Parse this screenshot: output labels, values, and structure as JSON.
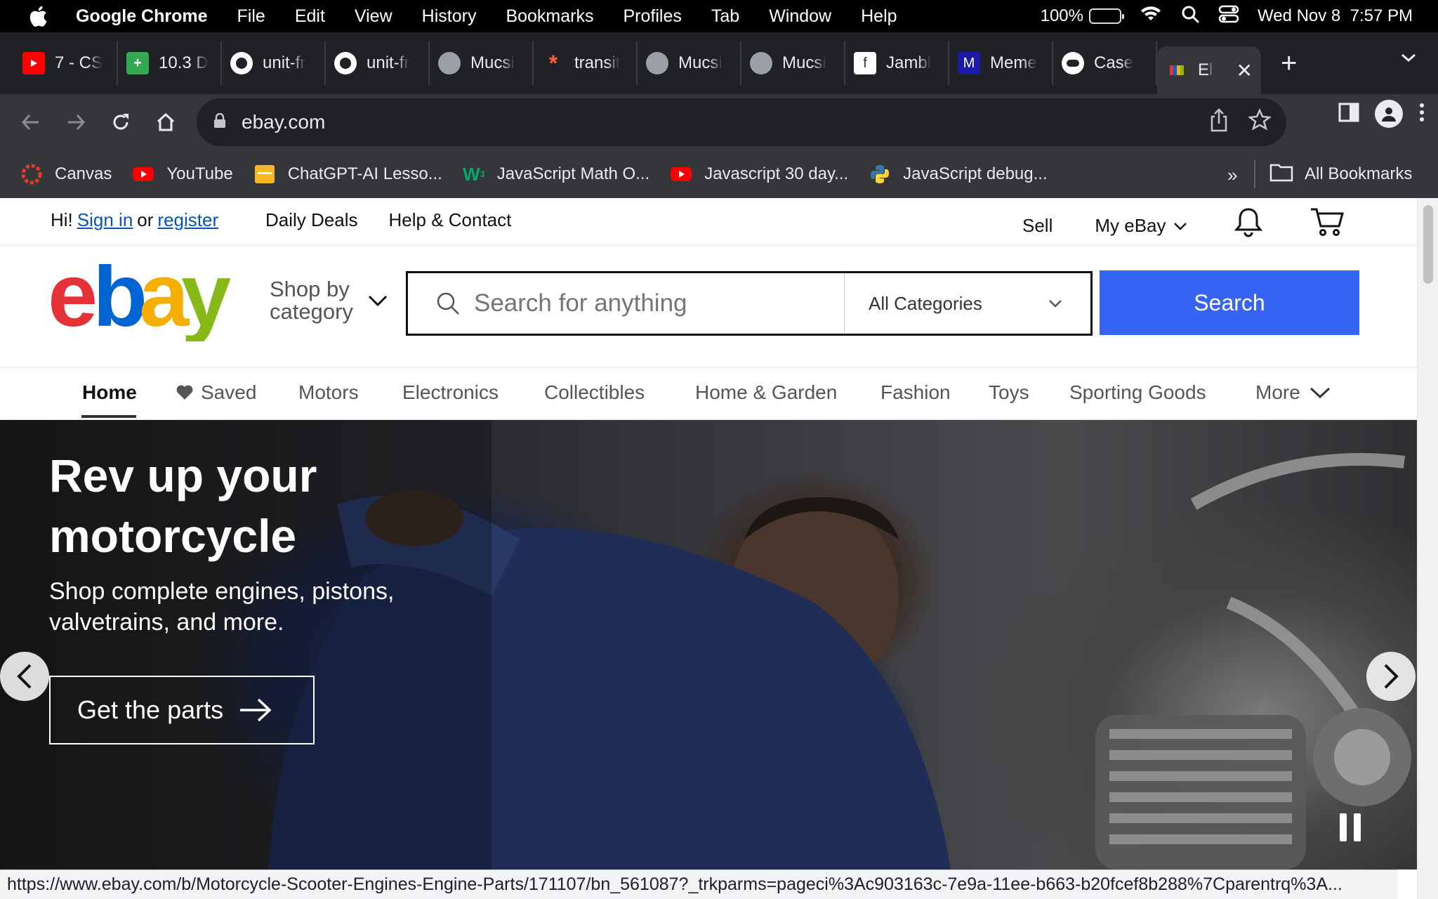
{
  "menubar": {
    "app_name": "Google Chrome",
    "items": [
      "File",
      "Edit",
      "View",
      "History",
      "Bookmarks",
      "Profiles",
      "Tab",
      "Window",
      "Help"
    ],
    "battery": "100%",
    "datetime": "Wed Nov 8  7:57 PM"
  },
  "tabs": [
    {
      "title": "7 - CS",
      "icon": "youtube-icon",
      "color": "#ff0000"
    },
    {
      "title": "10.3 D",
      "icon": "green-plus-icon",
      "color": "#34a853"
    },
    {
      "title": "unit-fr",
      "icon": "github-icon",
      "color": "#ffffff"
    },
    {
      "title": "unit-fr",
      "icon": "github-icon",
      "color": "#ffffff"
    },
    {
      "title": "Mucsi",
      "icon": "globe-icon",
      "color": "#9aa0a6"
    },
    {
      "title": "transit",
      "icon": "asterisk-icon",
      "color": "#ff5a36"
    },
    {
      "title": "Mucsi",
      "icon": "globe-icon",
      "color": "#9aa0a6"
    },
    {
      "title": "Mucsi",
      "icon": "globe-icon",
      "color": "#9aa0a6"
    },
    {
      "title": "Jambl",
      "icon": "f-icon",
      "color": "#ffffff"
    },
    {
      "title": "Meme",
      "icon": "m-icon",
      "color": "#1a1aa6"
    },
    {
      "title": "Case",
      "icon": "chrome-dino-icon",
      "color": "#ffffff"
    },
    {
      "title": "El",
      "icon": "ebay-favicon",
      "color": "#e53238",
      "active": true
    }
  ],
  "omnibox": {
    "url": "ebay.com"
  },
  "bookmarks": [
    {
      "label": "Canvas",
      "icon": "canvas-icon"
    },
    {
      "label": "YouTube",
      "icon": "youtube-icon"
    },
    {
      "label": "ChatGPT-AI Lesso...",
      "icon": "folder-doc-icon"
    },
    {
      "label": "JavaScript Math O...",
      "icon": "w3-icon"
    },
    {
      "label": "Javascript 30 day...",
      "icon": "youtube-icon"
    },
    {
      "label": "JavaScript debug...",
      "icon": "python-icon"
    }
  ],
  "bookmarks_more": "»",
  "all_bookmarks": "All Bookmarks",
  "ebay": {
    "greeting": "Hi!",
    "sign_in": "Sign in",
    "or": "or",
    "register": "register",
    "daily_deals": "Daily Deals",
    "help_contact": "Help & Contact",
    "sell": "Sell",
    "my_ebay": "My eBay",
    "shop_by": "Shop by",
    "category": "category",
    "search_placeholder": "Search for anything",
    "all_categories": "All Categories",
    "search_button": "Search",
    "nav": [
      "Home",
      "Saved",
      "Motors",
      "Electronics",
      "Collectibles",
      "Home & Garden",
      "Fashion",
      "Toys",
      "Sporting Goods",
      "More"
    ],
    "hero": {
      "title": "Rev up your motorcycle",
      "subtitle": "Shop complete engines, pistons, valvetrains, and more.",
      "cta": "Get the parts"
    }
  },
  "status_url": "https://www.ebay.com/b/Motorcycle-Scooter-Engines-Engine-Parts/171107/bn_561087?_trkparms=pageci%3Ac903163c-7e9a-11ee-b663-b20fcef8b288%7Cparentrq%3A..."
}
